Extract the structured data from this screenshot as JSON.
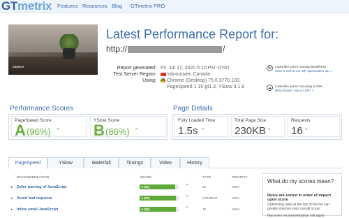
{
  "header": {
    "logo_gt": "GT",
    "logo_metrix": "metrix",
    "nav": [
      "Features",
      "Resources",
      "Blog",
      "GTmetrix PRO"
    ]
  },
  "report": {
    "title": "Latest Performance Report for:",
    "url_prefix": "http://",
    "url_suffix": "/",
    "thumb_caption": "SAMPLE",
    "meta": [
      {
        "label": "Report generated:",
        "value": "Fri, Jul 17, 2020 5:10 PM -0700"
      },
      {
        "label": "Test Server Region:",
        "value": "Vancouver, Canada"
      },
      {
        "label": "Using:",
        "value": "Chrome (Desktop) 75.0.3770.100,"
      },
      {
        "label": "",
        "value": "PageSpeed 1.15-gt1.3, YSlow 3.1.8"
      }
    ],
    "tips": [
      {
        "text": "Looks like you're running WordPress",
        "link": "Have a look at our WP optimization tips »"
      },
      {
        "text": "Looks like you're not using a CDN",
        "link": "Why should I use a CDN? »"
      }
    ]
  },
  "scores": {
    "heading": "Performance Scores",
    "pagespeed": {
      "label": "PageSpeed Score",
      "grade": "A",
      "pct": "(96%)",
      "trend": "^"
    },
    "yslow": {
      "label": "YSlow Score",
      "grade": "B",
      "pct": "(86%)",
      "trend": "^"
    }
  },
  "details": {
    "heading": "Page Details",
    "items": [
      {
        "label": "Fully Loaded Time",
        "value": "1.5s",
        "trend": "^"
      },
      {
        "label": "Total Page Size",
        "value": "230KB",
        "trend": "^"
      },
      {
        "label": "Requests",
        "value": "16",
        "trend": "^"
      }
    ]
  },
  "tabs": [
    "PageSpeed",
    "YSlow",
    "Waterfall",
    "Timings",
    "Video",
    "History"
  ],
  "table": {
    "headers": {
      "rec": "RECOMMENDATION",
      "grade": "GRADE",
      "type": "TYPE",
      "priority": "PRIORITY"
    },
    "rows": [
      {
        "name": "Defer parsing of JavaScript",
        "grade": "A (91)",
        "type": "JS",
        "priority": "HIGH",
        "pct": 0.91
      },
      {
        "name": "Avoid bad requests",
        "grade": "A (92)",
        "type": "CONTENT",
        "priority": "HIGH",
        "pct": 0.92
      },
      {
        "name": "Inline small JavaScript",
        "grade": "A (92)",
        "type": "JS",
        "priority": "HIGH",
        "pct": 0.92
      }
    ]
  },
  "sidebar": {
    "heading": "What do my scores mean?",
    "p1": "Rules are sorted in order of impact upon score",
    "p2": "Optimizing rules at the top of the list can greatly improve your overall score.",
    "p3": "Not every recommendation will apply"
  }
}
